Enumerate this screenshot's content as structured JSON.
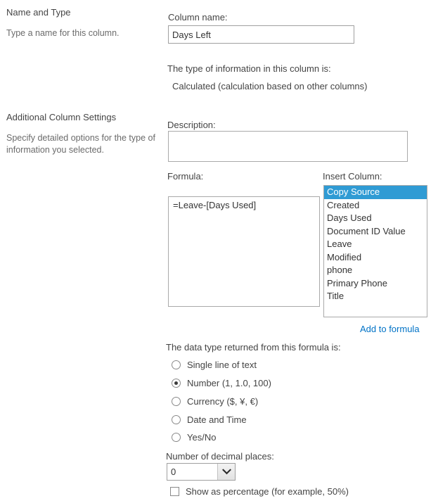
{
  "sections": [
    {
      "title": "Name and Type",
      "description": "Type a name for this column."
    },
    {
      "title": "Additional Column Settings",
      "description": "Specify detailed options for the type of information you selected."
    }
  ],
  "column_name": {
    "label": "Column name:",
    "value": "Days Left"
  },
  "type_of_information": {
    "label": "The type of information in this column is:",
    "value": "Calculated (calculation based on other columns)"
  },
  "description_field": {
    "label": "Description:",
    "value": ""
  },
  "formula": {
    "label": "Formula:",
    "value": "=Leave-[Days Used]"
  },
  "insert_column": {
    "label": "Insert Column:",
    "options": [
      "Copy Source",
      "Created",
      "Days Used",
      "Document ID Value",
      "Leave",
      "Modified",
      "phone",
      "Primary Phone",
      "Title"
    ],
    "selected": "Copy Source",
    "add_link": "Add to formula"
  },
  "data_type": {
    "label": "The data type returned from this formula is:",
    "options": [
      "Single line of text",
      "Number (1, 1.0, 100)",
      "Currency ($, ¥, €)",
      "Date and Time",
      "Yes/No"
    ],
    "selected": "Number (1, 1.0, 100)"
  },
  "decimal_places": {
    "label": "Number of decimal places:",
    "value": "0"
  },
  "show_as_percentage": {
    "label": "Show as percentage (for example, 50%)",
    "checked": false
  },
  "colors": {
    "accent_selection": "#2f9bd4",
    "link": "#0072c6",
    "heading_text": "#444444",
    "muted_text": "#6b6b6b"
  }
}
